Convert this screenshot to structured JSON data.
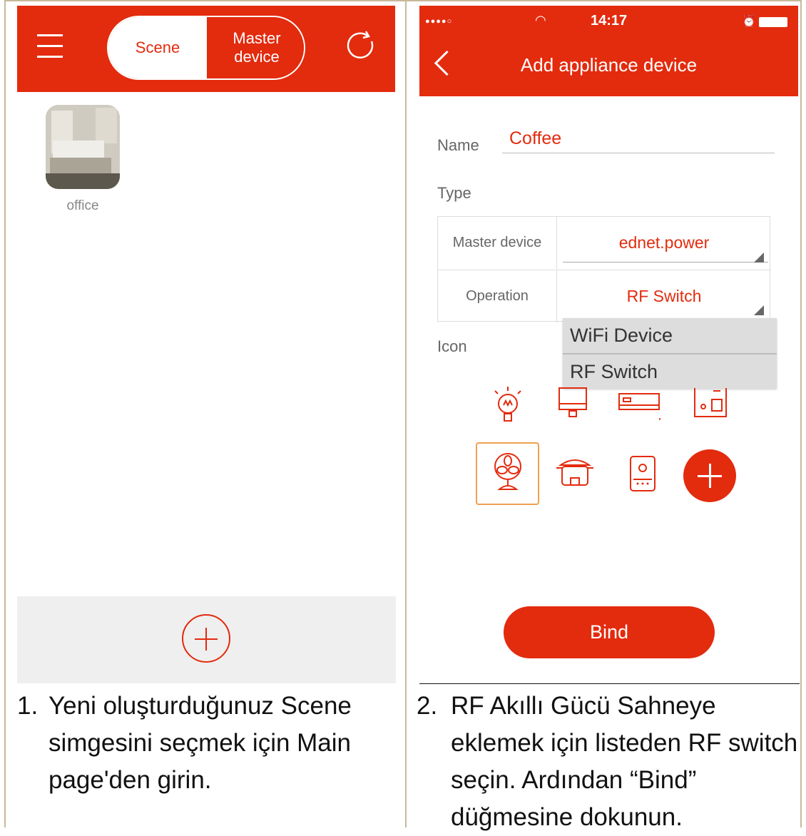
{
  "left_panel": {
    "tabs": {
      "scene": "Scene",
      "master_device": "Master device"
    },
    "scenes": [
      {
        "label": "office"
      }
    ],
    "caption_number": "1.",
    "caption": "Yeni oluşturduğunuz Scene simgesini seçmek için Main page'den girin."
  },
  "right_panel": {
    "status_bar": {
      "signal": "●●●●○",
      "time": "14:17"
    },
    "title": "Add appliance device",
    "form": {
      "name_label": "Name",
      "name_value": "Coffee",
      "type_label": "Type",
      "master_device_label": "Master device",
      "master_device_value": "ednet.power",
      "operation_label": "Operation",
      "operation_value": "RF Switch",
      "icon_label": "Icon"
    },
    "dropdown_options": [
      "WiFi Device",
      "RF Switch"
    ],
    "icons": [
      "bulb-icon",
      "monitor-icon",
      "air-conditioner-icon",
      "coffee-machine-icon",
      "fan-icon",
      "rice-cooker-icon",
      "speaker-icon",
      "add-icon"
    ],
    "bind_label": "Bind",
    "caption_number": "2.",
    "caption": "RF Akıllı Gücü Sahneye eklemek için listeden RF switch seçin. Ardından “Bind” düğmesine dokunun."
  },
  "colors": {
    "accent": "#e32b0e",
    "selection": "#f0a050"
  }
}
